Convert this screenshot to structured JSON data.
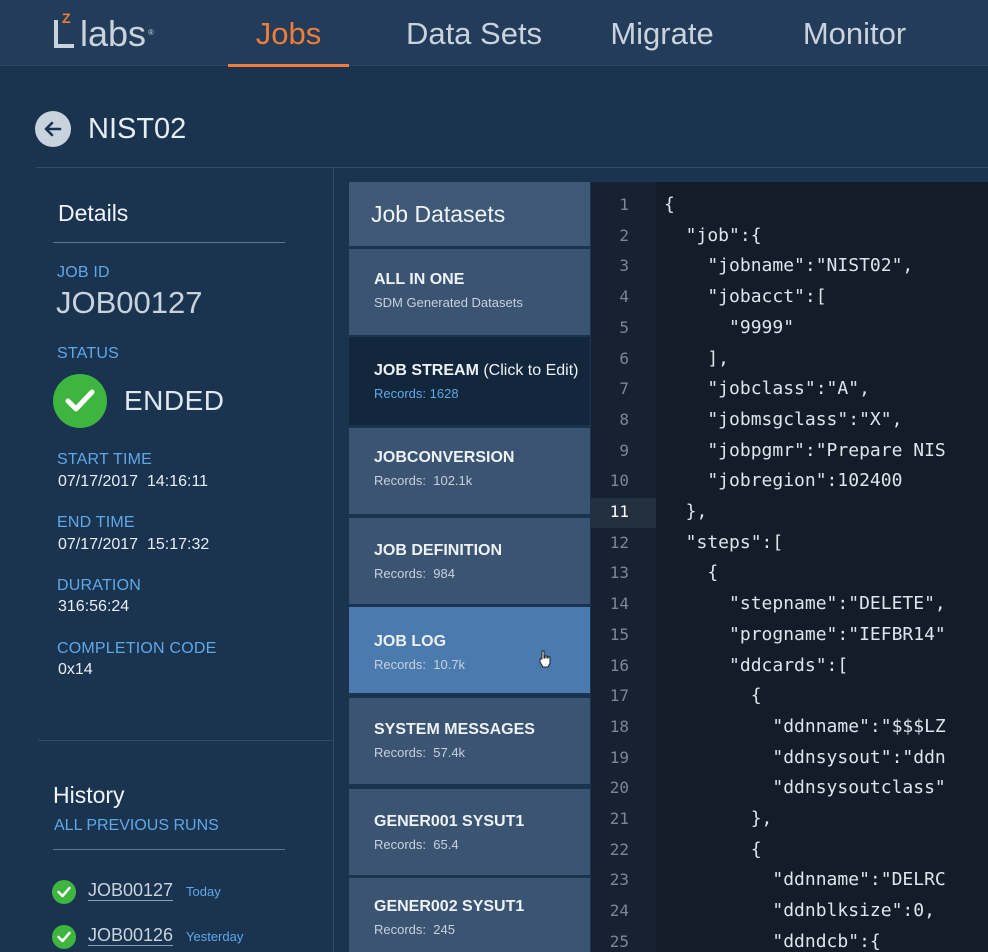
{
  "app": {
    "logo_text": "labs",
    "logo_mark": "Z",
    "nav": [
      {
        "label": "Jobs",
        "active": true
      },
      {
        "label": "Data Sets",
        "active": false
      },
      {
        "label": "Migrate",
        "active": false
      },
      {
        "label": "Monitor",
        "active": false
      }
    ],
    "accent_color": "#f07c3a"
  },
  "page": {
    "title": "NIST02",
    "back_icon": "arrow-left-icon"
  },
  "details": {
    "heading": "Details",
    "job_id_label": "JOB ID",
    "job_id": "JOB00127",
    "status_label": "STATUS",
    "status": "ENDED",
    "status_color": "#3db53f",
    "start_time_label": "START TIME",
    "start_time": "07/17/2017  14:16:11",
    "end_time_label": "END TIME",
    "end_time": "07/17/2017  15:17:32",
    "duration_label": "DURATION",
    "duration": "316:56:24",
    "completion_code_label": "COMPLETION CODE",
    "completion_code": "0x14"
  },
  "history": {
    "heading": "History",
    "all_runs_link": "ALL PREVIOUS RUNS",
    "runs": [
      {
        "id": "JOB00127",
        "when": "Today"
      },
      {
        "id": "JOB00126",
        "when": "Yesterday"
      }
    ]
  },
  "datasets": {
    "heading": "Job Datasets",
    "items": [
      {
        "name": "ALL IN ONE",
        "name_suffix": "",
        "sub": "SDM Generated Datasets"
      },
      {
        "name": "JOB STREAM",
        "name_suffix": " (Click to Edit)",
        "sub": "Records: 1628"
      },
      {
        "name": "JOBCONVERSION",
        "name_suffix": "",
        "sub": "Records:  102.1k"
      },
      {
        "name": "JOB DEFINITION",
        "name_suffix": "",
        "sub": "Records:  984"
      },
      {
        "name": "JOB LOG",
        "name_suffix": "",
        "sub": "Records:  10.7k"
      },
      {
        "name": "SYSTEM MESSAGES",
        "name_suffix": "",
        "sub": "Records:  57.4k"
      },
      {
        "name": "GENER001 SYSUT1",
        "name_suffix": "",
        "sub": "Records:  65.4"
      },
      {
        "name": "GENER002 SYSUT1",
        "name_suffix": "",
        "sub": "Records:  245"
      }
    ]
  },
  "editor": {
    "active_line": 11,
    "lines": [
      {
        "n": "1",
        "text": "{"
      },
      {
        "n": "2",
        "text": "  \"job\":{"
      },
      {
        "n": "3",
        "text": "    \"jobname\":\"NIST02\","
      },
      {
        "n": "4",
        "text": "    \"jobacct\":["
      },
      {
        "n": "5",
        "text": "      \"9999\""
      },
      {
        "n": "6",
        "text": "    ],"
      },
      {
        "n": "7",
        "text": "    \"jobclass\":\"A\","
      },
      {
        "n": "8",
        "text": "    \"jobmsgclass\":\"X\","
      },
      {
        "n": "9",
        "text": "    \"jobpgmr\":\"Prepare NIS"
      },
      {
        "n": "10",
        "text": "    \"jobregion\":102400"
      },
      {
        "n": "11",
        "text": "  },"
      },
      {
        "n": "12",
        "text": "  \"steps\":["
      },
      {
        "n": "13",
        "text": "    {"
      },
      {
        "n": "14",
        "text": "      \"stepname\":\"DELETE\","
      },
      {
        "n": "15",
        "text": "      \"progname\":\"IEFBR14\""
      },
      {
        "n": "16",
        "text": "      \"ddcards\":["
      },
      {
        "n": "17",
        "text": "        {"
      },
      {
        "n": "18",
        "text": "          \"ddnname\":\"$$$LZ"
      },
      {
        "n": "19",
        "text": "          \"ddnsysout\":\"ddn"
      },
      {
        "n": "20",
        "text": "          \"ddnsysoutclass\""
      },
      {
        "n": "21",
        "text": "        },"
      },
      {
        "n": "22",
        "text": "        {"
      },
      {
        "n": "23",
        "text": "          \"ddnname\":\"DELRC"
      },
      {
        "n": "24",
        "text": "          \"ddnblksize\":0,"
      },
      {
        "n": "25",
        "text": "          \"ddndcb\":{"
      }
    ]
  }
}
